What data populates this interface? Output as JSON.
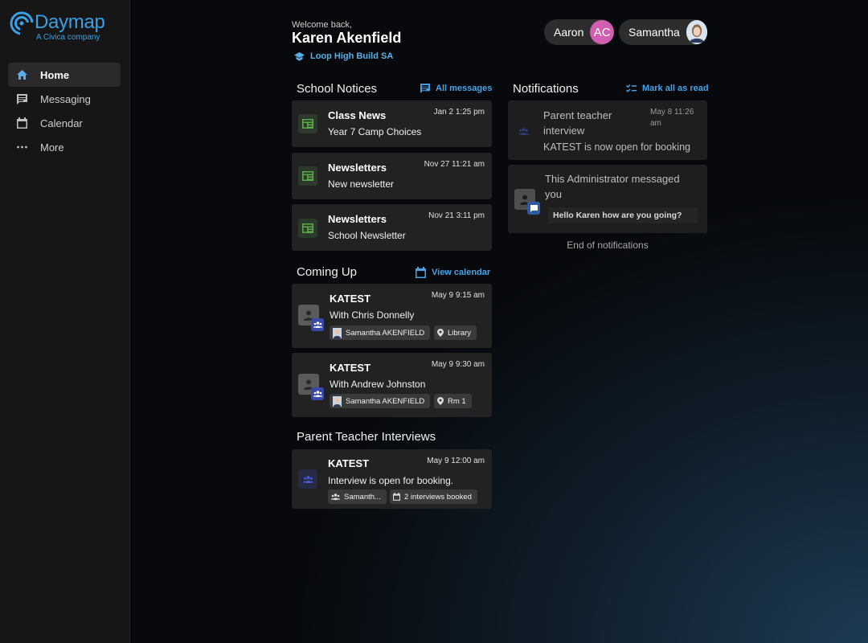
{
  "app": {
    "logo_name": "Daymap",
    "logo_sub": "A Civica company"
  },
  "sidebar": {
    "items": [
      {
        "label": "Home",
        "icon": "home-icon"
      },
      {
        "label": "Messaging",
        "icon": "message-icon"
      },
      {
        "label": "Calendar",
        "icon": "calendar-icon"
      },
      {
        "label": "More",
        "icon": "more-icon"
      }
    ]
  },
  "header": {
    "welcome": "Welcome back,",
    "user_name": "Karen Akenfield",
    "school": "Loop High Build SA",
    "profiles": [
      {
        "name": "Aaron",
        "initials": "AC",
        "color": "#d05fb0"
      },
      {
        "name": "Samantha",
        "initials": "",
        "color": "#b0c4d8"
      }
    ]
  },
  "notices": {
    "title": "School Notices",
    "link": "All messages",
    "items": [
      {
        "title": "Class News",
        "subtitle": "Year 7 Camp Choices",
        "time": "Jan 2 1:25 pm"
      },
      {
        "title": "Newsletters",
        "subtitle": "New newsletter",
        "time": "Nov 27 11:21 am"
      },
      {
        "title": "Newsletters",
        "subtitle": "School Newsletter",
        "time": "Nov 21 3:11 pm"
      }
    ]
  },
  "coming_up": {
    "title": "Coming Up",
    "link": "View calendar",
    "items": [
      {
        "title": "KATEST",
        "subtitle": "With Chris Donnelly",
        "time": "May 9 9:15 am",
        "person": "Samantha AKENFIELD",
        "location": "Library"
      },
      {
        "title": "KATEST",
        "subtitle": "With Andrew Johnston",
        "time": "May 9 9:30 am",
        "person": "Samantha AKENFIELD",
        "location": "Rm 1"
      }
    ]
  },
  "interviews": {
    "title": "Parent Teacher Interviews",
    "items": [
      {
        "title": "KATEST",
        "subtitle": "Interview is open for booking.",
        "time": "May 9 12:00 am",
        "person": "Samanth...",
        "booked": "2 interviews booked"
      }
    ]
  },
  "notifications": {
    "title": "Notifications",
    "link": "Mark all as read",
    "items": [
      {
        "title_line1": "Parent teacher",
        "title_line2": "interview",
        "body": "KATEST is now open for booking",
        "time_line1": "May 8 11:26",
        "time_line2": "am"
      },
      {
        "title_line1": "This Administrator messaged",
        "title_line2": "you",
        "body": "Hello Karen how are you going?"
      }
    ],
    "end": "End of notifications"
  },
  "colors": {
    "accent": "#4aa3e6",
    "group_badge": "#3949a8",
    "notice_icon": "#5da84a"
  }
}
